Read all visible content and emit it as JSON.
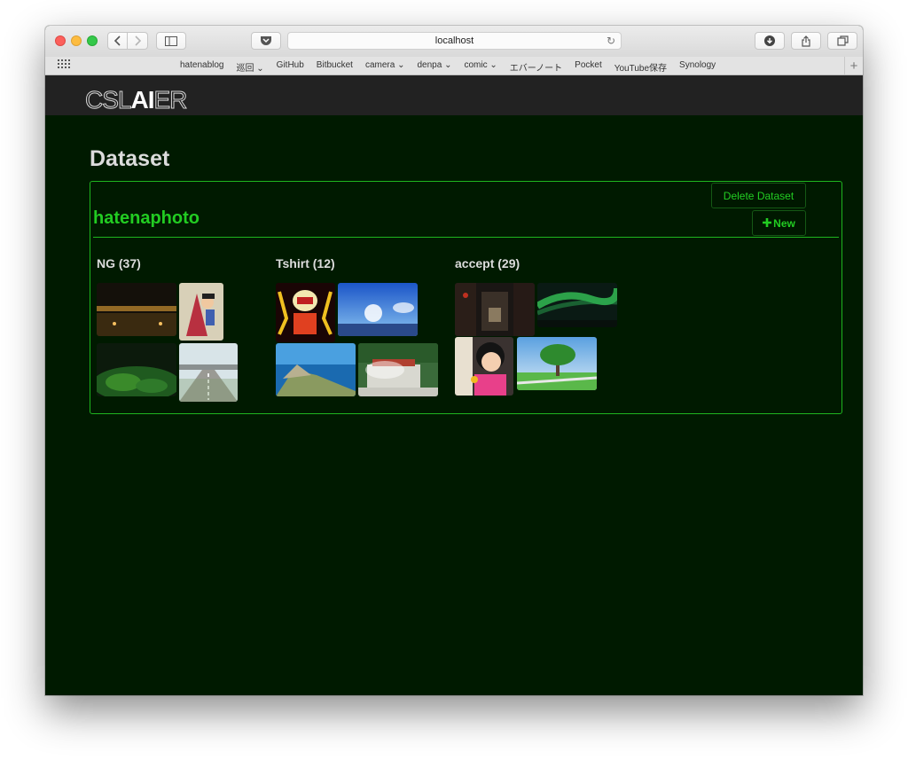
{
  "browser": {
    "url": "localhost",
    "bookmarks": [
      "hatenablog",
      "巡回",
      "GitHub",
      "Bitbucket",
      "camera",
      "denpa",
      "comic",
      "エバーノート",
      "Pocket",
      "YouTube保存",
      "Synology"
    ],
    "bookmarks_with_menu": [
      "巡回",
      "camera",
      "denpa",
      "comic"
    ]
  },
  "app": {
    "logo_thin_1": "CSL",
    "logo_bold": "AI",
    "logo_thin_2": "ER"
  },
  "page": {
    "title": "Dataset",
    "dataset_name": "hatenaphoto",
    "delete_label": "Delete Dataset",
    "new_label": "New"
  },
  "categories": [
    {
      "label": "NG (37)"
    },
    {
      "label": "Tshirt (12)"
    },
    {
      "label": "accept (29)"
    }
  ],
  "colors": {
    "accent": "#22cc22",
    "page_bg": "#001a00",
    "header_bg": "#222222"
  }
}
